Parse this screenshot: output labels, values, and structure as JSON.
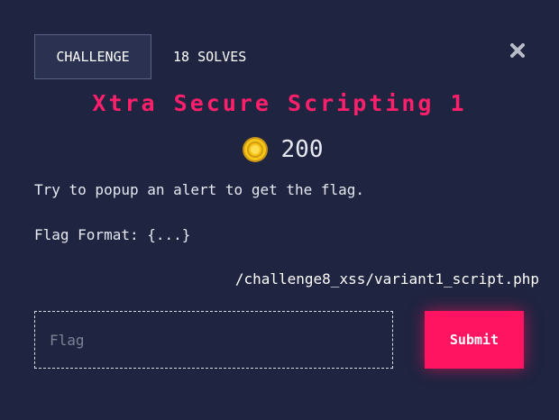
{
  "header": {
    "challenge_tab": "CHALLENGE",
    "solves_tab": "18 SOLVES",
    "close_icon": "close-x-icon"
  },
  "challenge": {
    "title": "Xtra Secure Scripting 1",
    "points": "200",
    "points_icon": "coin-icon",
    "description": "Try to popup an alert to get the flag.",
    "flag_format": "Flag Format: {...}",
    "link": "/challenge8_xss/variant1_script.php"
  },
  "form": {
    "flag_placeholder": "Flag",
    "flag_value": "",
    "submit_label": "Submit"
  },
  "colors": {
    "background": "#1f2440",
    "accent": "#ff1461",
    "title": "#ff1f6b",
    "coin": "#f5c518"
  }
}
